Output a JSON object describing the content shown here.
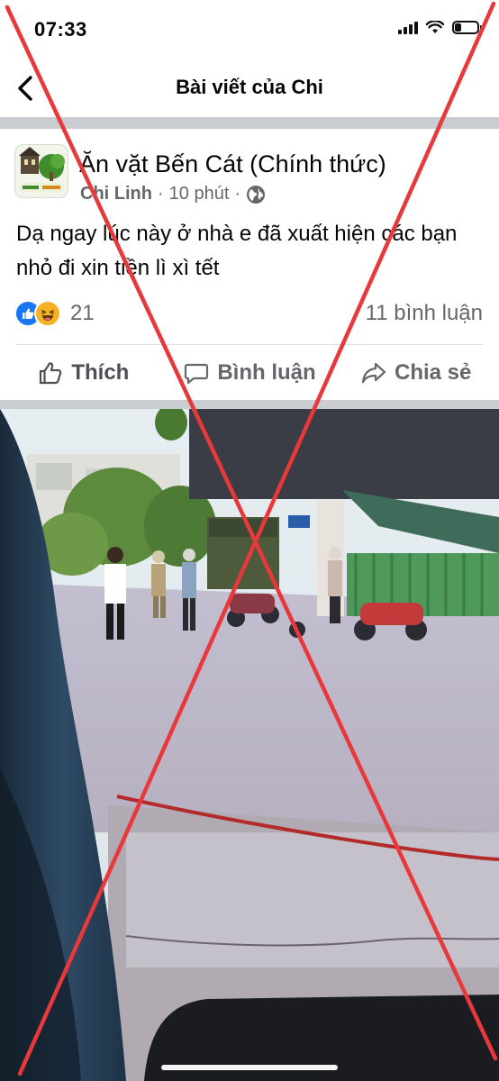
{
  "status_bar": {
    "time": "07:33",
    "battery_level": 0.2
  },
  "nav": {
    "title": "Bài viết của Chi",
    "back_icon": "chevron-left-icon"
  },
  "post": {
    "page_name": "Ăn vặt Bến Cát (Chính thức)",
    "author": "Chi Linh",
    "separator": "·",
    "time": "10 phút",
    "audience_icon": "globe-icon",
    "text": "Dạ ngay lúc này ở nhà e đã xuất hiện các bạn nhỏ đi xin tiền lì xì tết",
    "reaction_count": "21",
    "comment_count": "11 bình luận"
  },
  "actions": {
    "like": "Thích",
    "comment": "Bình luận",
    "share": "Chia sẻ"
  },
  "colors": {
    "accent_blue": "#1877f2",
    "overlay_red": "#e8383b",
    "meta_gray": "#65676b"
  }
}
